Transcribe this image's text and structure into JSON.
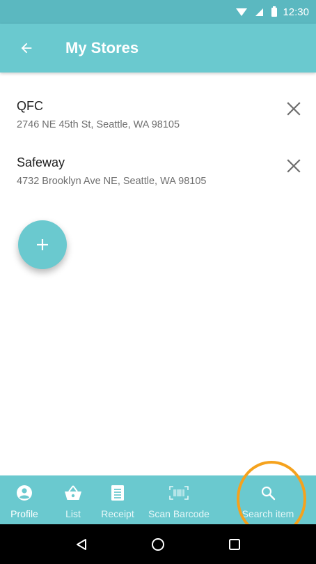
{
  "status_bar": {
    "time": "12:30",
    "icons": [
      "wifi-icon",
      "signal-icon",
      "battery-icon"
    ],
    "color": "#5bb8c0"
  },
  "app_bar": {
    "title": "My Stores",
    "back_icon": "arrow-back-icon",
    "color": "#6ac9cf"
  },
  "stores": [
    {
      "name": "QFC",
      "address": "2746 NE 45th St, Seattle, WA 98105",
      "remove_icon": "close-icon"
    },
    {
      "name": "Safeway",
      "address": "4732 Brooklyn Ave NE, Seattle, WA 98105",
      "remove_icon": "close-icon"
    }
  ],
  "fab": {
    "icon": "plus-icon",
    "color": "#6ac9cf"
  },
  "bottom_nav": {
    "selected": "Profile",
    "items": [
      {
        "label": "Profile",
        "icon": "account-circle-icon"
      },
      {
        "label": "List",
        "icon": "basket-icon"
      },
      {
        "label": "Receipt",
        "icon": "receipt-icon"
      },
      {
        "label": "Scan Barcode",
        "icon": "barcode-scan-icon"
      },
      {
        "label": "Search item",
        "icon": "search-icon"
      }
    ],
    "highlight_color": "#f5a21d"
  },
  "system_nav": {
    "icons": [
      "back-triangle-icon",
      "home-circle-icon",
      "recents-square-icon"
    ]
  }
}
